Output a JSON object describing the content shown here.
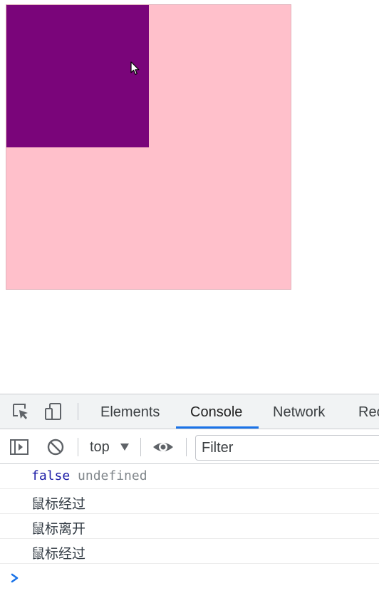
{
  "page": {
    "outer_box_color": "#ffc0cb",
    "inner_box_color": "#7a057a",
    "cursor_icon": "arrow-cursor-icon"
  },
  "devtools": {
    "tabs": [
      {
        "label": "Elements",
        "active": false
      },
      {
        "label": "Console",
        "active": true
      },
      {
        "label": "Network",
        "active": false
      },
      {
        "label": "Rec",
        "active": false
      }
    ],
    "toolbar": {
      "context": "top",
      "filter_placeholder": "Filter"
    },
    "console": {
      "first_line": {
        "left": "false",
        "right": "undefined"
      },
      "messages": [
        "鼠标经过",
        "鼠标离开",
        "鼠标经过"
      ]
    },
    "accent_color": "#1a73e8"
  }
}
